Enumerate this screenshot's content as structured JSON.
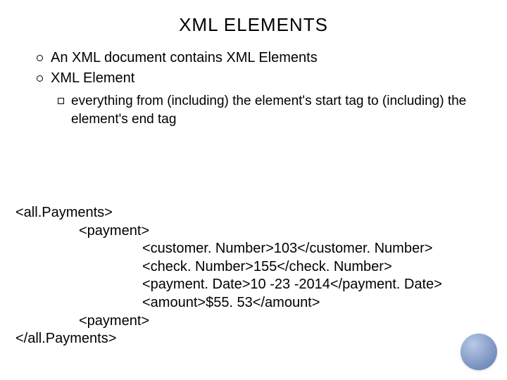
{
  "title_a": "XML E",
  "title_b": "LEMENTS",
  "bullets": [
    "An XML document contains XML Elements",
    "XML Element"
  ],
  "subbullet": "everything from (including) the element's start tag to (including) the element's end tag",
  "code": {
    "l0a": "<all.Payments>",
    "l1a": "<payment>",
    "l2a": "<customer. Number>103</customer. Number>",
    "l2b": "<check. Number>155</check. Number>",
    "l2c": "<payment. Date>10 -23 -2014</payment. Date>",
    "l2d": "<amount>$55. 53</amount>",
    "l1b": "<payment>",
    "l0b": "</all.Payments>"
  }
}
